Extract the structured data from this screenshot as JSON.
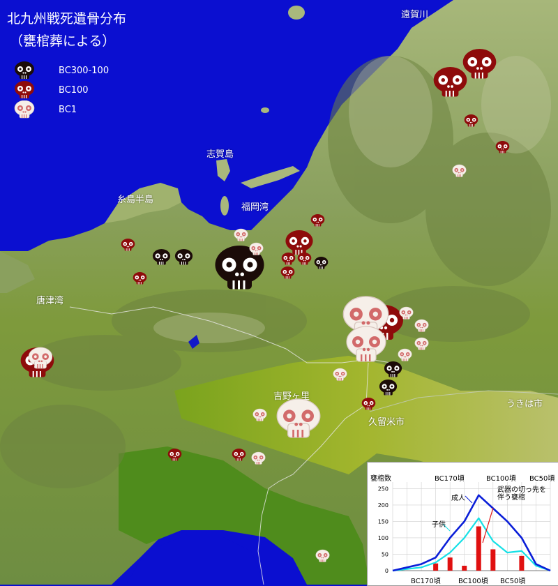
{
  "title": "北九州戦死遺骨分布",
  "subtitle": "（甕棺葬による）",
  "legend": [
    {
      "label": "BC300-100",
      "color": "#1b0b08"
    },
    {
      "label": "BC100",
      "color": "#8e0b0b"
    },
    {
      "label": "BC1",
      "color": "#f6efe9"
    }
  ],
  "places": {
    "onga": "遠賀川",
    "shika": "志賀島",
    "itoshima": "糸島半島",
    "fukuoka_bay": "福岡湾",
    "karatsu_bay": "唐津湾",
    "yoshinogari": "吉野ヶ里",
    "kurume": "久留米市",
    "ukiha": "うきは市"
  },
  "markers": [
    {
      "period": "BC100",
      "size": "large"
    },
    {
      "period": "BC100",
      "size": "large"
    },
    {
      "period": "BC300-100",
      "size": "large"
    },
    {
      "period": "BC1",
      "size": "large"
    },
    {
      "period": "BC1",
      "size": "large"
    },
    {
      "period": "BC1",
      "size": "large"
    },
    {
      "period": "BC100",
      "size": "large"
    },
    {
      "period": "BC300-100",
      "size": "medium"
    },
    {
      "period": "BC100",
      "size": "medium"
    }
  ],
  "chart_data": {
    "type": "line",
    "ylabel": "甕棺数",
    "top_labels": [
      "BC170頃",
      "BC100頃",
      "BC50頃"
    ],
    "bottom_labels": [
      "BC170頃",
      "BC100頃",
      "BC50頃"
    ],
    "yticks": [
      0,
      50,
      100,
      150,
      200,
      250
    ],
    "ylim": [
      0,
      270
    ],
    "series": [
      {
        "name": "成人",
        "color": "#0a1ed8",
        "values": [
          0,
          10,
          20,
          40,
          100,
          150,
          230,
          190,
          150,
          100,
          20,
          0
        ]
      },
      {
        "name": "子供",
        "color": "#16e0e6",
        "values": [
          0,
          5,
          10,
          25,
          55,
          100,
          160,
          90,
          55,
          60,
          15,
          0
        ]
      },
      {
        "name": "武器の切っ先を伴う甕棺",
        "color": "#e01010",
        "values": [
          0,
          0,
          0,
          22,
          40,
          15,
          135,
          65,
          0,
          45,
          0,
          0
        ]
      }
    ],
    "annotation": "武器の切っ先を伴う甕棺"
  }
}
